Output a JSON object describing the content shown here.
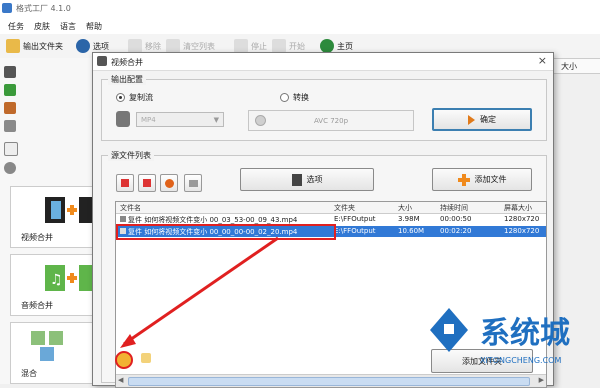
{
  "app": {
    "title": "格式工厂 4.1.0"
  },
  "menu": [
    "任务",
    "皮肤",
    "语言",
    "帮助"
  ],
  "toolbar": {
    "output_folder": "输出文件夹",
    "options": "选项",
    "remove": "移除",
    "clear_list": "清空列表",
    "stop": "停止",
    "start": "开始",
    "home": "主页"
  },
  "right_header": "大小",
  "categories": [
    "视频合并",
    "音频合并",
    "混合"
  ],
  "dialog": {
    "title": "视频合并",
    "output_config_label": "输出配置",
    "copy_stream": "复制流",
    "transcode": "转换",
    "format_value": "MP4",
    "codec_value": "AVC 720p",
    "ok": "确定",
    "source_list_label": "源文件列表",
    "options": "选项",
    "add_file": "添加文件",
    "add_folder": "添加文件夹"
  },
  "file_table": {
    "columns": [
      "文件名",
      "文件夹",
      "大小",
      "持续时间",
      "屏幕大小"
    ],
    "rows": [
      {
        "name": "复件 如何将视频文件变小 00_03_53-00_09_43.mp4",
        "folder": "E:\\FFOutput",
        "size": "3.98M",
        "duration": "00:00:50",
        "screen": "1280x720"
      },
      {
        "name": "复件 如何将视频文件变小 00_00_00-00_02_20.mp4",
        "folder": "E:\\FFOutput",
        "size": "10.60M",
        "duration": "00:02:20",
        "screen": "1280x720"
      }
    ],
    "selected_index": 1
  },
  "watermark": {
    "cn": "系统城",
    "en": "XITONGCHENG.COM"
  },
  "colors": {
    "selection": "#3179d6",
    "annotation": "#e02020",
    "watermark": "#1f6fc0"
  }
}
